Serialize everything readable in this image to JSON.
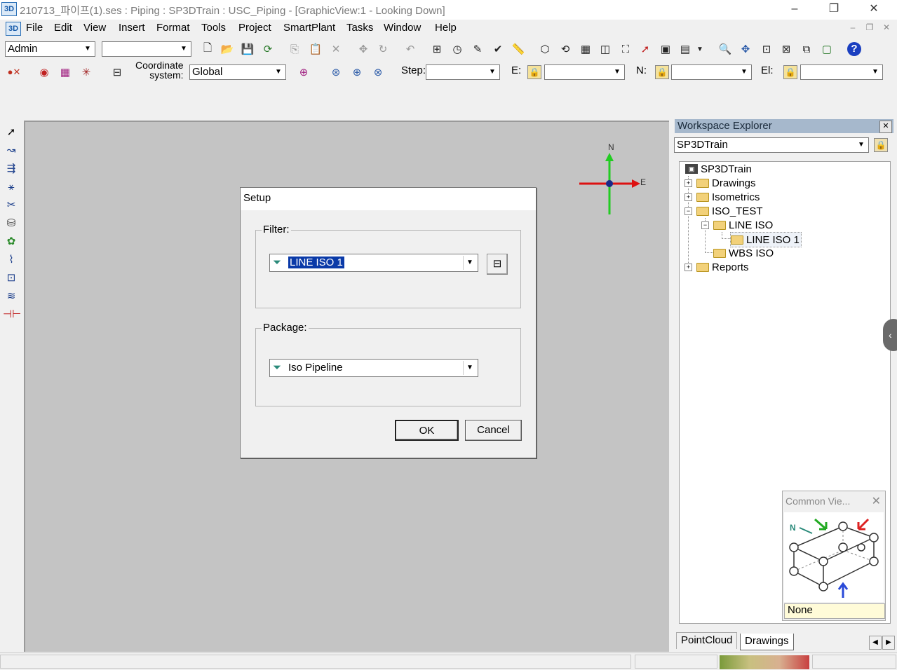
{
  "window": {
    "title": "210713_파이프(1).ses : Piping : SP3DTrain : USC_Piping - [GraphicView:1 - Looking Down]",
    "app_icon_text": "3D",
    "controls": {
      "minimize": "–",
      "restore": "❐",
      "close": "✕"
    }
  },
  "menu": {
    "items": [
      "File",
      "Edit",
      "View",
      "Insert",
      "Format",
      "Tools",
      "Project",
      "SmartPlant",
      "Tasks",
      "Window",
      "Help"
    ],
    "mdi_controls": {
      "minimize": "–",
      "restore": "❐",
      "close": "✕"
    }
  },
  "toolbar1": {
    "permission_group": "Admin",
    "second_combo_value": ""
  },
  "toolbar2": {
    "coordinate_label_line1": "Coordinate",
    "coordinate_label_line2": "system:",
    "coordinate_system": "Global",
    "step_label": "Step:",
    "step_value": "",
    "e_label": "E:",
    "e_value": "",
    "n_label": "N:",
    "n_value": "",
    "el_label": "El:",
    "el_value": ""
  },
  "compass": {
    "north": "N",
    "east": "E"
  },
  "setup_dialog": {
    "title": "Setup",
    "filter_label": "Filter:",
    "filter_value": "LINE ISO 1",
    "package_label": "Package:",
    "package_value": "Iso Pipeline",
    "ok_label": "OK",
    "cancel_label": "Cancel"
  },
  "workspace_explorer": {
    "title": "Workspace Explorer",
    "filter_combo": "SP3DTrain",
    "tree": {
      "root": "SP3DTrain",
      "drawings": "Drawings",
      "isometrics": "Isometrics",
      "iso_test": "ISO_TEST",
      "line_iso": "LINE ISO",
      "line_iso_1": "LINE ISO 1",
      "wbs_iso": "WBS ISO",
      "reports": "Reports"
    },
    "tabs": [
      "PointCloud",
      "Drawings"
    ]
  },
  "common_views": {
    "title": "Common Vie...",
    "north_label": "N",
    "status": "None"
  },
  "colors": {
    "graphic_view_bg": "#c4c4c4",
    "selection": "#0a3aa8",
    "compass_north": "#22cc22",
    "compass_east": "#dd1111",
    "panel_title": "#a6b8cc"
  }
}
